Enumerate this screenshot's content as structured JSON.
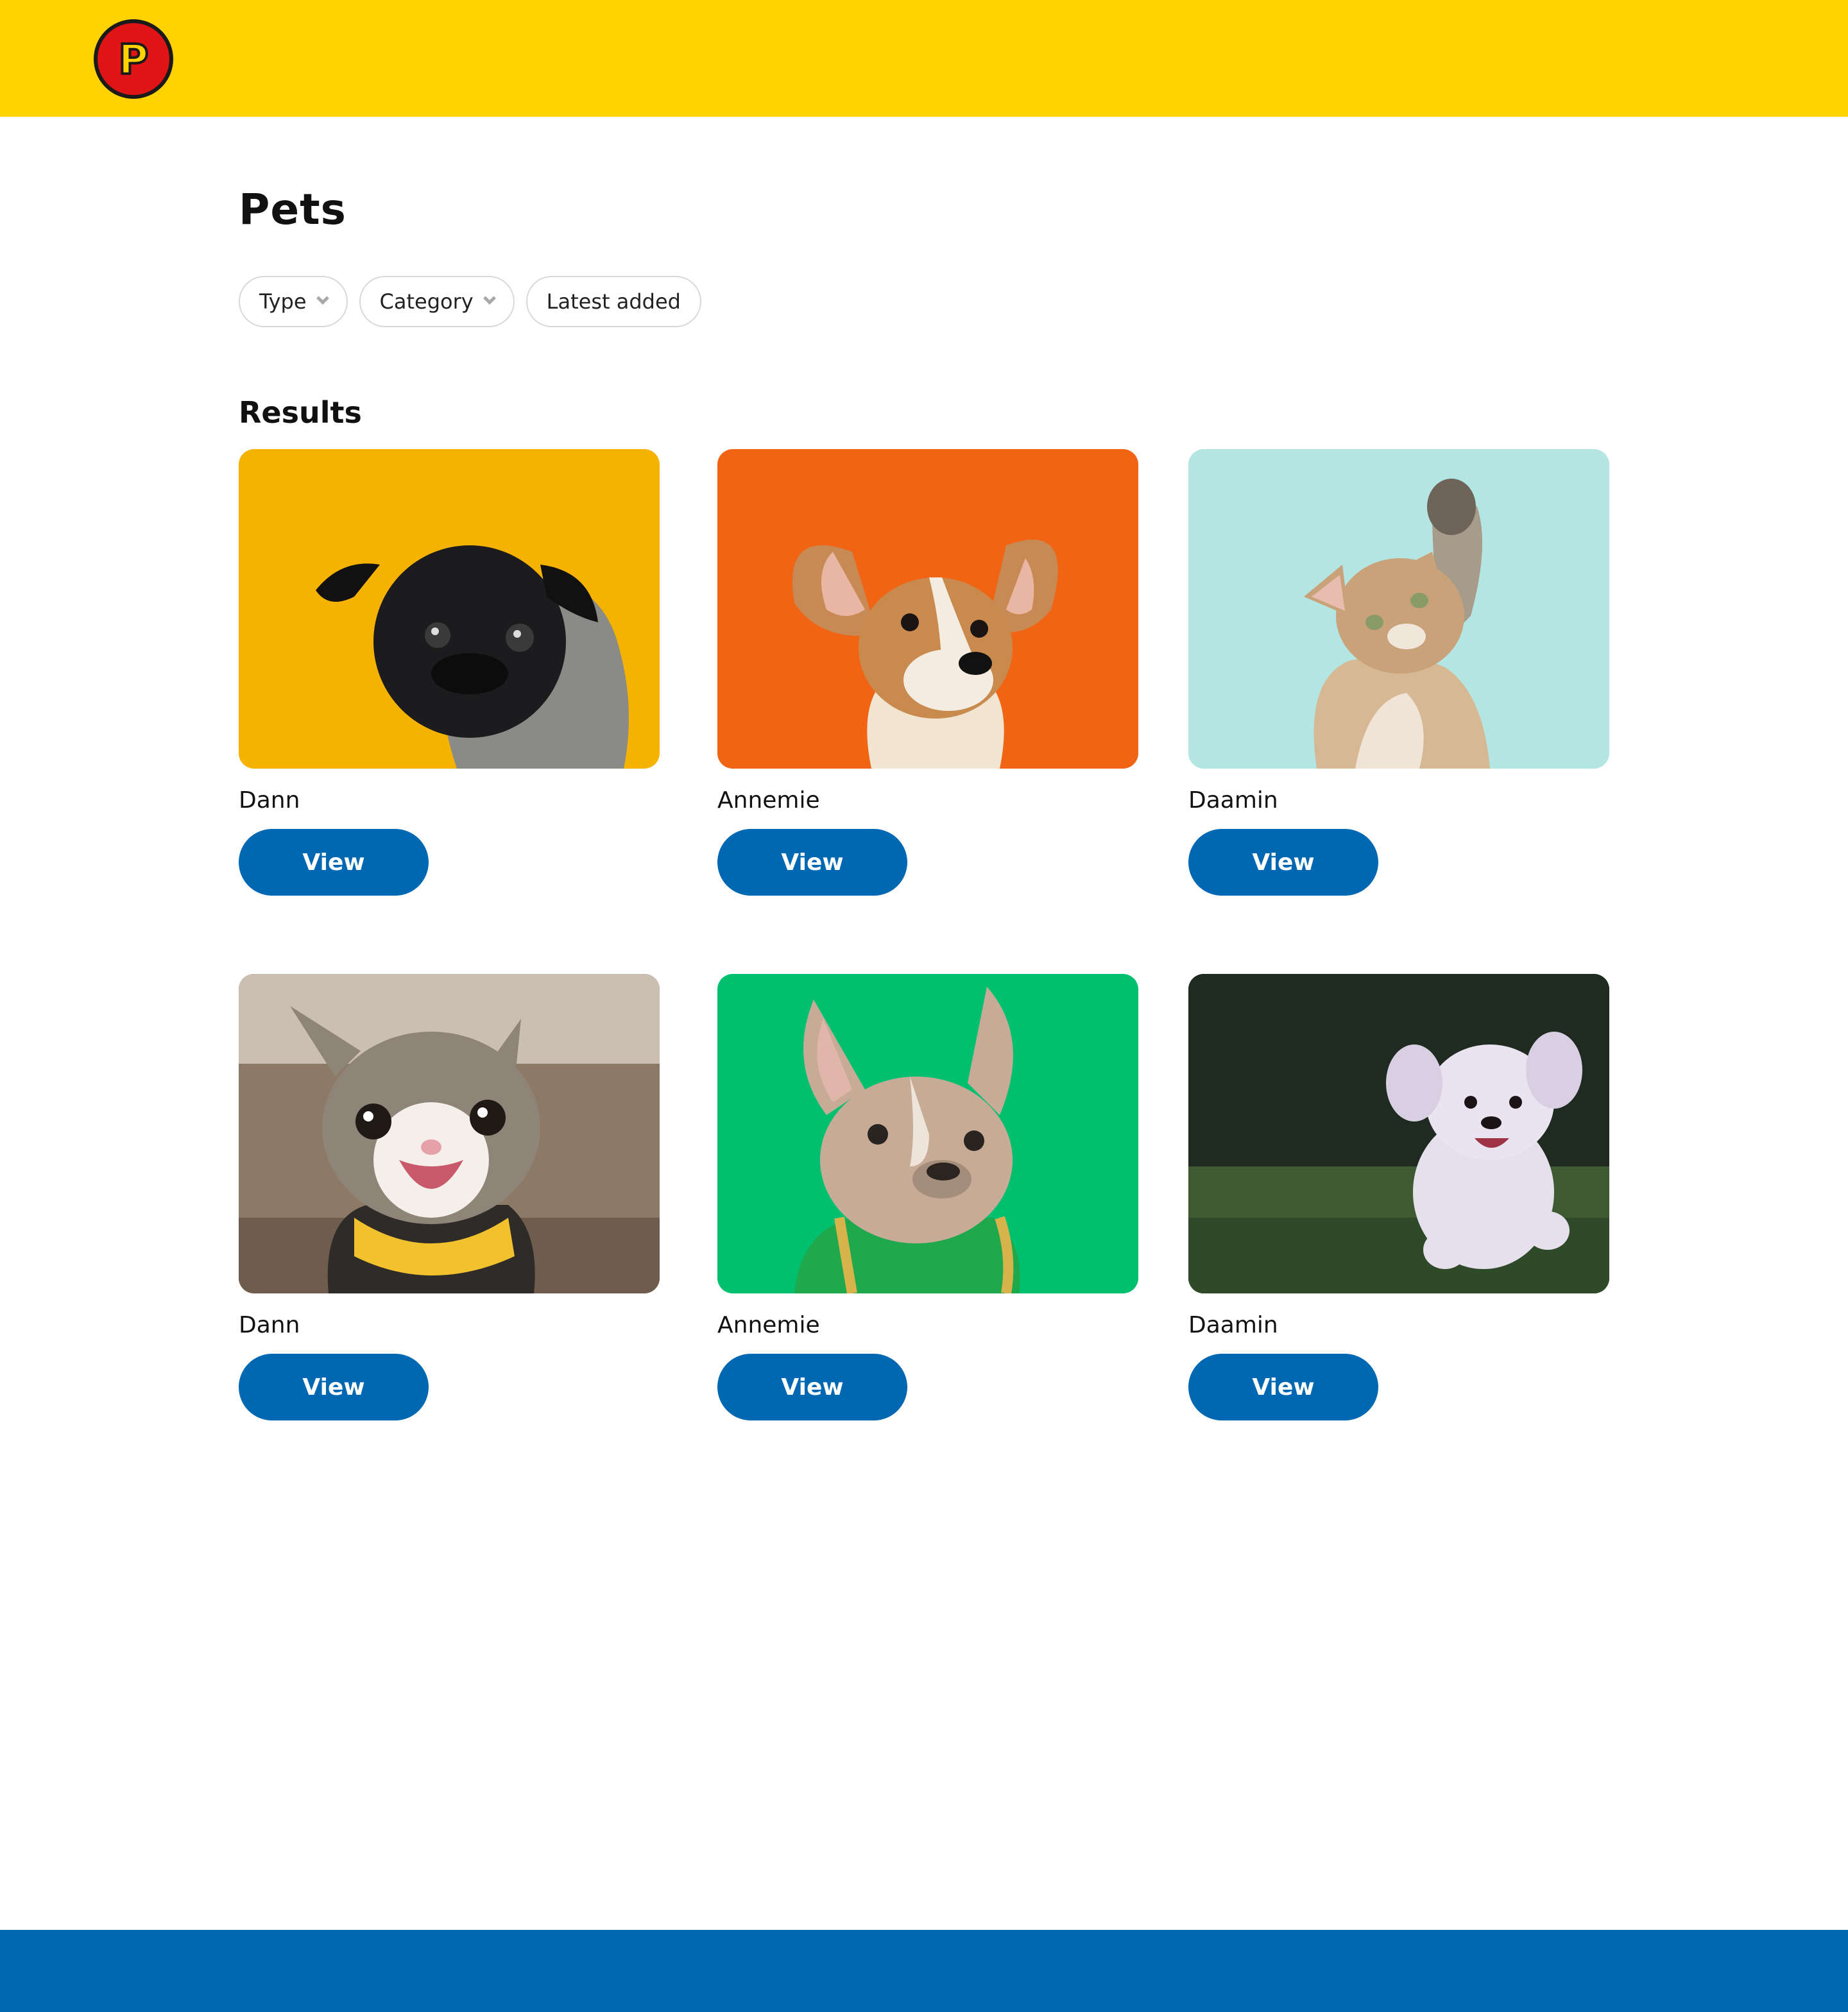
{
  "colors": {
    "header_bg": "#ffd200",
    "logo_bg": "#e01414",
    "footer_bg": "#0068b3",
    "button_bg": "#0068b3"
  },
  "header": {
    "logo_letter": "P"
  },
  "page": {
    "title": "Pets"
  },
  "filters": [
    {
      "label": "Type",
      "icon": "chevron-down-icon"
    },
    {
      "label": "Category",
      "icon": "chevron-down-icon"
    },
    {
      "label": "Latest added"
    }
  ],
  "results": {
    "heading": "Results",
    "items": [
      {
        "name": "Dann",
        "button": "View",
        "photo_bg": "#f5b300",
        "animal": "black pug"
      },
      {
        "name": "Annemie",
        "button": "View",
        "photo_bg": "#f06414",
        "animal": "corgi puppy"
      },
      {
        "name": "Daamin",
        "button": "View",
        "photo_bg": "#b3e6e3",
        "animal": "kitten raising paw"
      },
      {
        "name": "Dann",
        "button": "View",
        "photo_bg": "#8d7a66",
        "animal": "laughing tabby cat"
      },
      {
        "name": "Annemie",
        "button": "View",
        "photo_bg": "#00c070",
        "animal": "french bulldog with chain"
      },
      {
        "name": "Daamin",
        "button": "View",
        "photo_bg": "#1f2a20",
        "animal": "white fluffy dog running"
      }
    ]
  }
}
